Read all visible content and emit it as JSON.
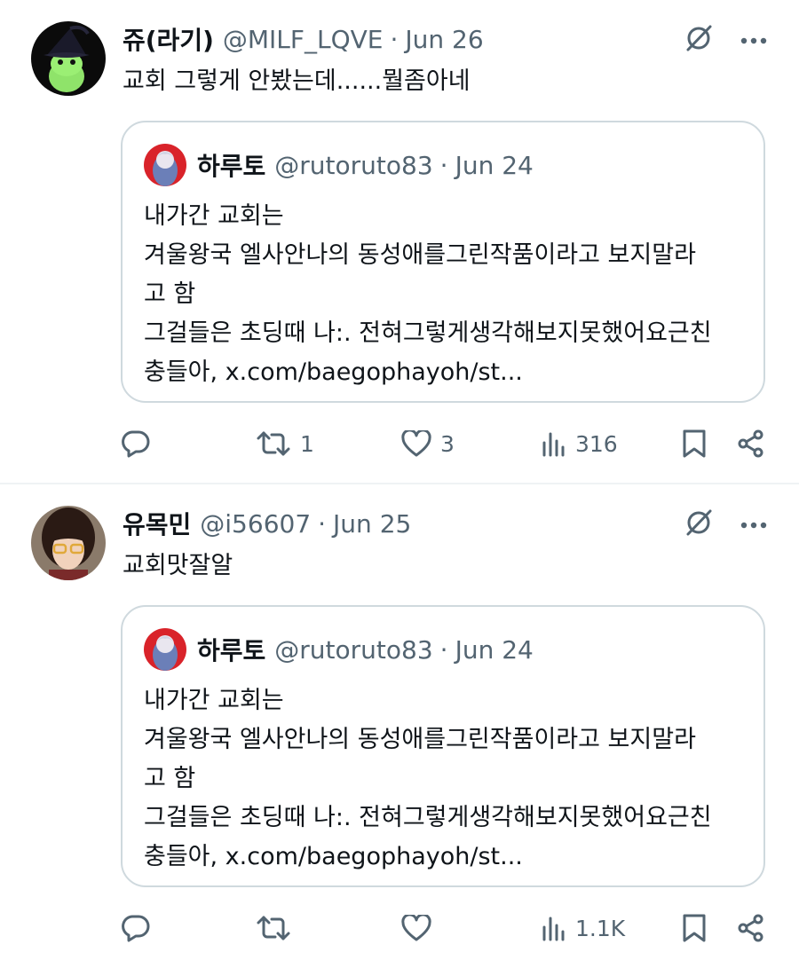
{
  "tweets": [
    {
      "author": {
        "name": "쥬(라기)",
        "handle": "@MILF_LQVE",
        "date": "Jun 26"
      },
      "text": "교회 그렇게 안봤는데......뭘좀아네",
      "quote": {
        "author": {
          "name": "하루토",
          "handle": "@rutoruto83",
          "date": "Jun 24"
        },
        "lines": [
          "내가간 교회는",
          "겨울왕국 엘사안나의 동성애를그린작품이라고 보지말라",
          "고 함",
          "그걸들은 초딩때 나:. 전혀그렇게생각해보지못했어요근친",
          "충들아, x.com/baegophayoh/st..."
        ]
      },
      "stats": {
        "replies": "",
        "reposts": "1",
        "likes": "3",
        "views": "316"
      }
    },
    {
      "author": {
        "name": "유목민",
        "handle": "@i56607",
        "date": "Jun 25"
      },
      "text": "교회맛잘알",
      "quote": {
        "author": {
          "name": "하루토",
          "handle": "@rutoruto83",
          "date": "Jun 24"
        },
        "lines": [
          "내가간 교회는",
          "겨울왕국 엘사안나의 동성애를그린작품이라고 보지말라",
          "고 함",
          "그걸들은 초딩때 나:. 전혀그렇게생각해보지못했어요근친",
          "충들아, x.com/baegophayoh/st..."
        ]
      },
      "stats": {
        "replies": "",
        "reposts": "",
        "likes": "",
        "views": "1.1K"
      }
    }
  ],
  "separator": "·",
  "icons": {
    "grok": "grok-icon",
    "more": "more-options-icon",
    "reply": "reply-icon",
    "repost": "repost-icon",
    "like": "like-icon",
    "views": "views-icon",
    "bookmark": "bookmark-icon",
    "share": "share-icon"
  },
  "colors": {
    "text": "#0f1419",
    "secondary": "#536471",
    "border": "#cfd9de"
  }
}
